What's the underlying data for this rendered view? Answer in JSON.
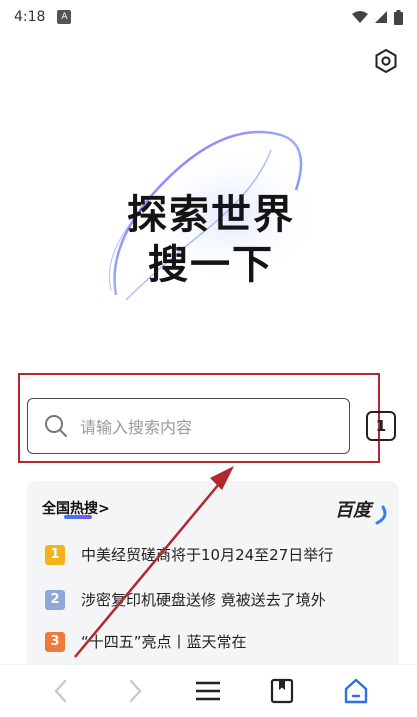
{
  "status_bar": {
    "time": "4:18",
    "notification_icon": "A"
  },
  "hero": {
    "line1": "探索世界",
    "line2": "搜一下"
  },
  "search": {
    "placeholder": "请输入搜索内容"
  },
  "tabs": {
    "count": "1"
  },
  "hot_search": {
    "title": "全国热搜>",
    "brand": "百度",
    "items": [
      {
        "rank": "1",
        "text": "中美经贸磋商将于10月24至27日举行",
        "color": "#f5b21b"
      },
      {
        "rank": "2",
        "text": "涉密复印机硬盘送修 竟被送去了境外",
        "color": "#8ea9d6"
      },
      {
        "rank": "3",
        "text": "“十四五”亮点丨蓝天常在",
        "color": "#ef7a3c"
      }
    ]
  },
  "colors": {
    "accent": "#2f6fe6",
    "annotation": "#b3272e"
  },
  "nav": {
    "icons": [
      "back-icon",
      "forward-icon",
      "menu-icon",
      "bookmark-icon",
      "home-icon"
    ]
  }
}
